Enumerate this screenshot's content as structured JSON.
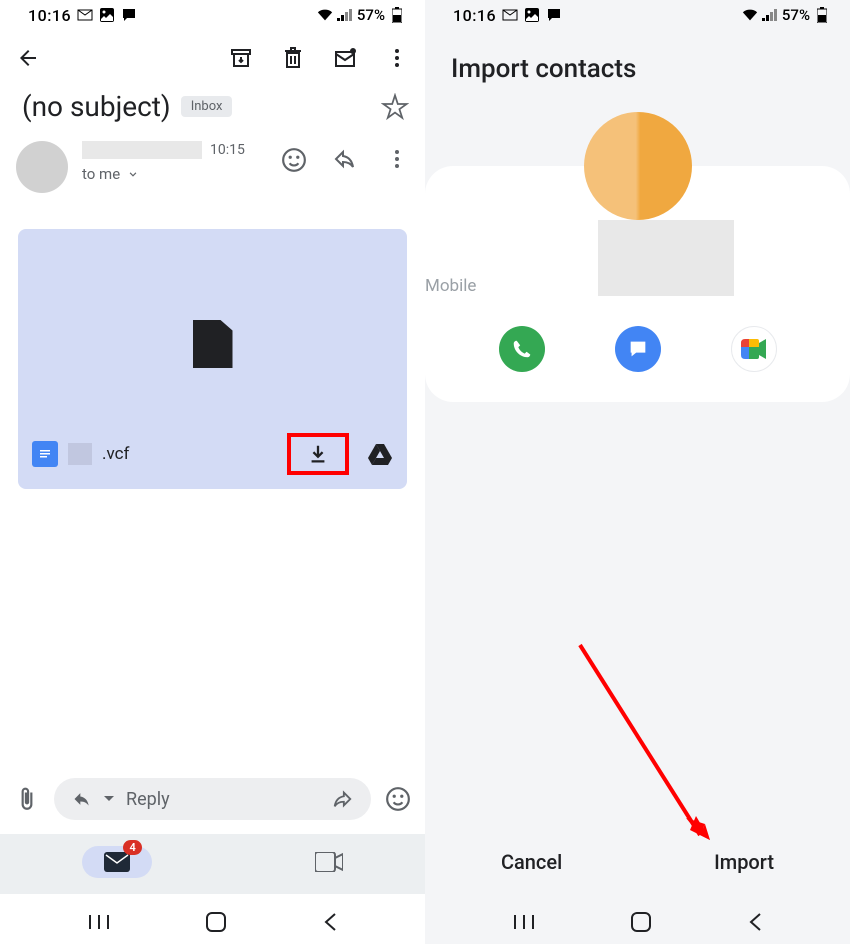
{
  "status": {
    "time": "10:16",
    "battery": "57%"
  },
  "gmail": {
    "subject": "(no subject)",
    "inbox_label": "Inbox",
    "email_time": "10:15",
    "to_text": "to me",
    "file_ext": ".vcf",
    "reply_placeholder": "Reply",
    "badge_count": "4"
  },
  "contacts": {
    "title": "Import contacts",
    "mobile_label": "Mobile",
    "cancel_btn": "Cancel",
    "import_btn": "Import"
  }
}
